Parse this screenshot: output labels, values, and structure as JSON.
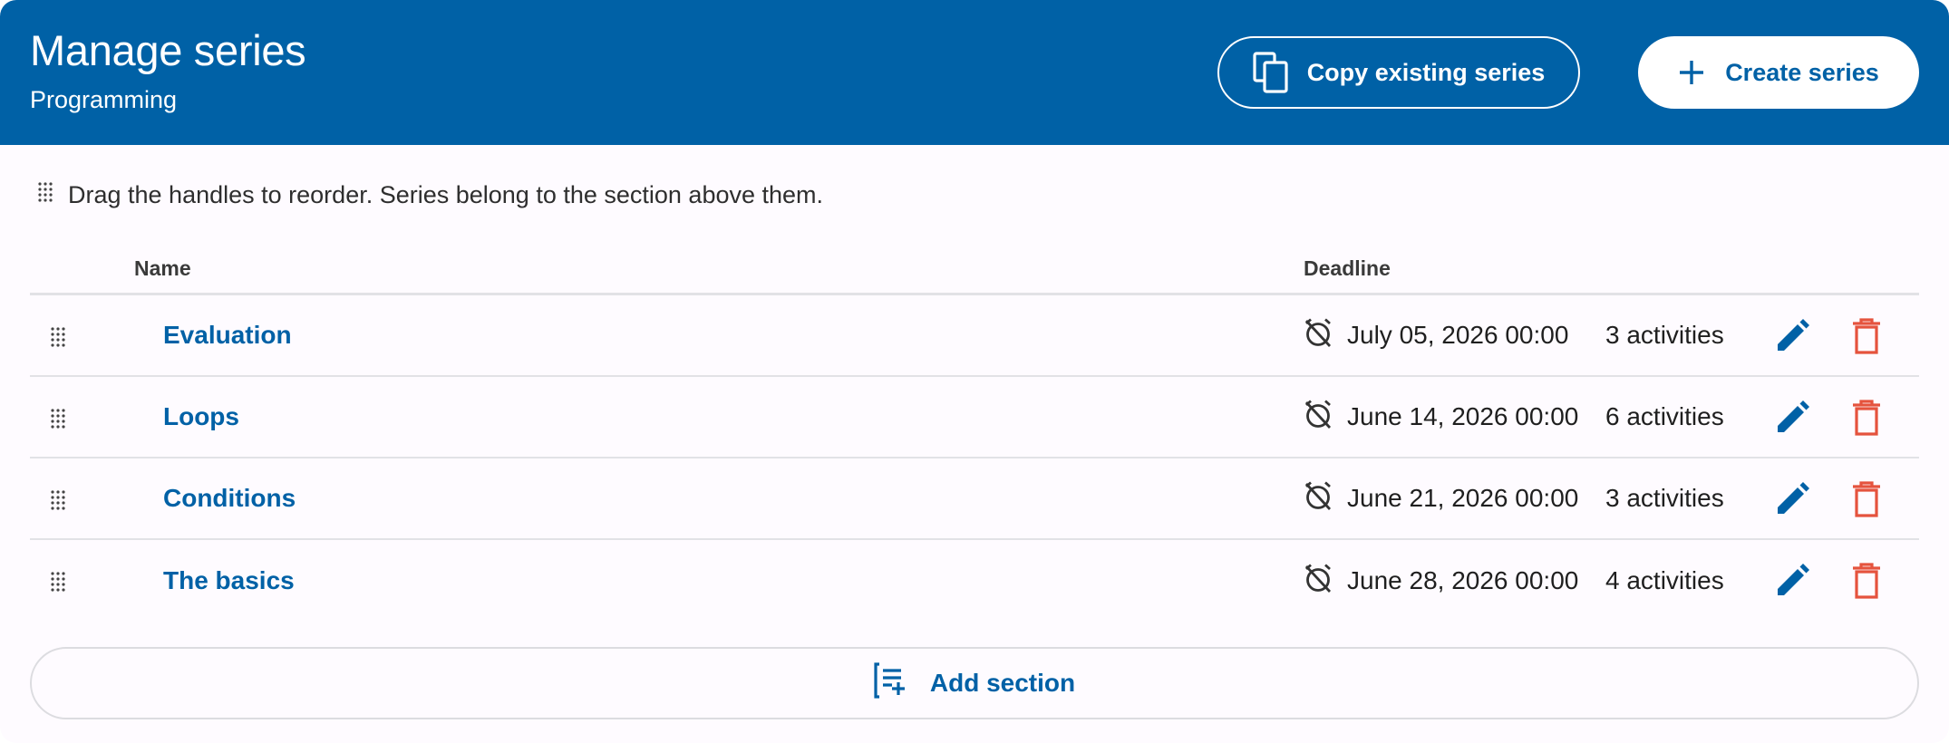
{
  "header": {
    "title": "Manage series",
    "subtitle": "Programming",
    "copy_label": "Copy existing series",
    "create_label": "Create series"
  },
  "hint": "Drag the handles to reorder. Series belong to the section above them.",
  "table": {
    "columns": {
      "name": "Name",
      "deadline": "Deadline"
    },
    "rows": [
      {
        "name": "Evaluation",
        "deadline": "July 05, 2026 00:00",
        "activities": "3 activities"
      },
      {
        "name": "Loops",
        "deadline": "June 14, 2026 00:00",
        "activities": "6 activities"
      },
      {
        "name": "Conditions",
        "deadline": "June 21, 2026 00:00",
        "activities": "3 activities"
      },
      {
        "name": "The basics",
        "deadline": "June 28, 2026 00:00",
        "activities": "4 activities"
      }
    ]
  },
  "add_section_label": "Add section",
  "colors": {
    "primary": "#0061a6",
    "danger": "#e5533d",
    "background": "#fefbff"
  },
  "icons": {
    "copy": "copy-icon",
    "create": "plus-icon",
    "drag": "drag-handle-icon",
    "deadline": "alarm-off-icon",
    "edit": "pencil-icon",
    "delete": "trash-icon",
    "add_section": "playlist-add-icon"
  }
}
